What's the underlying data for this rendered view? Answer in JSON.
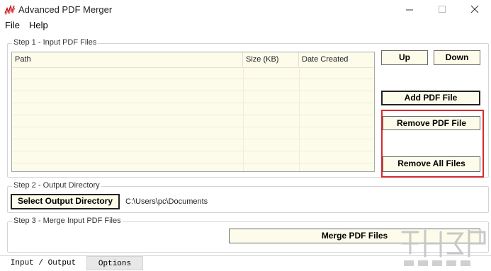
{
  "window": {
    "title": "Advanced PDF Merger",
    "controls": [
      "minimize",
      "maximize",
      "close"
    ]
  },
  "menu": {
    "file": "File",
    "help": "Help"
  },
  "step1": {
    "legend": "Step 1 - Input PDF Files",
    "columns": [
      "Path",
      "Size (KB)",
      "Date Created"
    ],
    "rows": [],
    "buttons": {
      "up": "Up",
      "down": "Down",
      "add": "Add PDF File",
      "remove": "Remove PDF File",
      "remove_all": "Remove All Files"
    }
  },
  "step2": {
    "legend": "Step 2 - Output Directory",
    "select_button": "Select Output Directory",
    "directory": "C:\\Users\\pc\\Documents"
  },
  "step3": {
    "legend": "Step 3 - Merge Input PDF Files",
    "merge_button": "Merge PDF Files"
  },
  "tabs": {
    "active": "Input / Output",
    "inactive": "Options"
  },
  "colors": {
    "panel_bg": "#fdfbea",
    "highlight": "#d62b2b"
  },
  "icons": {
    "app": "pdf-merger-logo-icon"
  }
}
